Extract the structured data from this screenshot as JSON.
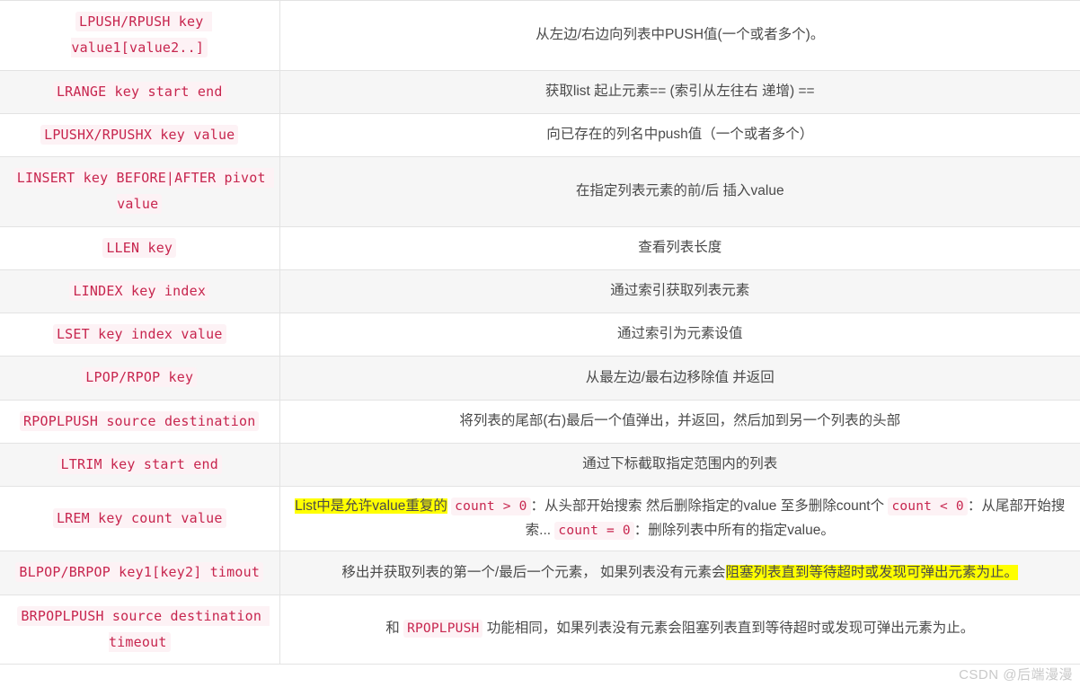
{
  "table": {
    "columns": [
      "command",
      "description"
    ],
    "rows": [
      {
        "command": "LPUSH/RPUSH key value1[value2..]",
        "description_parts": [
          {
            "type": "text",
            "text": "从左边/右边向列表中PUSH值(一个或者多个)。"
          }
        ],
        "striped": false
      },
      {
        "command": "LRANGE key start end",
        "description_parts": [
          {
            "type": "text",
            "text": "获取list 起止元素== (索引从左往右 递增) =="
          }
        ],
        "striped": true
      },
      {
        "command": "LPUSHX/RPUSHX key value",
        "description_parts": [
          {
            "type": "text",
            "text": "向已存在的列名中push值（一个或者多个）"
          }
        ],
        "striped": false
      },
      {
        "command": "LINSERT key BEFORE|AFTER pivot value",
        "description_parts": [
          {
            "type": "text",
            "text": "在指定列表元素的前/后 插入value"
          }
        ],
        "striped": true
      },
      {
        "command": "LLEN key",
        "description_parts": [
          {
            "type": "text",
            "text": "查看列表长度"
          }
        ],
        "striped": false
      },
      {
        "command": "LINDEX key index",
        "description_parts": [
          {
            "type": "text",
            "text": "通过索引获取列表元素"
          }
        ],
        "striped": true
      },
      {
        "command": "LSET key index value",
        "description_parts": [
          {
            "type": "text",
            "text": "通过索引为元素设值"
          }
        ],
        "striped": false
      },
      {
        "command": "LPOP/RPOP key",
        "description_parts": [
          {
            "type": "text",
            "text": "从最左边/最右边移除值 并返回"
          }
        ],
        "striped": true
      },
      {
        "command": "RPOPLPUSH source destination",
        "description_parts": [
          {
            "type": "text",
            "text": "将列表的尾部(右)最后一个值弹出，并返回，然后加到另一个列表的头部"
          }
        ],
        "striped": false
      },
      {
        "command": "LTRIM key start end",
        "description_parts": [
          {
            "type": "text",
            "text": "通过下标截取指定范围内的列表"
          }
        ],
        "striped": true
      },
      {
        "command": "LREM key count value",
        "description_parts": [
          {
            "type": "highlight",
            "text": "List中是允许value重复的"
          },
          {
            "type": "text",
            "text": " "
          },
          {
            "type": "code",
            "text": "count > 0"
          },
          {
            "type": "text",
            "text": "：从头部开始搜索 然后删除指定的value 至多删除count个 "
          },
          {
            "type": "code",
            "text": "count < 0"
          },
          {
            "type": "text",
            "text": "：从尾部开始搜索... "
          },
          {
            "type": "code",
            "text": "count = 0"
          },
          {
            "type": "text",
            "text": "：删除列表中所有的指定value。"
          }
        ],
        "striped": false
      },
      {
        "command": "BLPOP/BRPOP key1[key2] timout",
        "description_parts": [
          {
            "type": "text",
            "text": "移出并获取列表的第一个/最后一个元素， 如果列表没有元素会"
          },
          {
            "type": "highlight",
            "text": "阻塞列表直到等待超时或发现可弹出元素为止。"
          }
        ],
        "striped": true
      },
      {
        "command": "BRPOPLPUSH source destination timeout",
        "description_parts": [
          {
            "type": "text",
            "text": "和 "
          },
          {
            "type": "code",
            "text": "RPOPLPUSH"
          },
          {
            "type": "text",
            "text": " 功能相同，如果列表没有元素会阻塞列表直到等待超时或发现可弹出元素为止。"
          }
        ],
        "striped": false
      }
    ]
  },
  "watermark": {
    "text": "CSDN @后端漫漫"
  },
  "colors": {
    "code_text": "#c7254e",
    "code_background": "#fdf2f5",
    "highlight": "#ffff00",
    "row_stripe": "#f6f6f6",
    "border": "#e3e3e3",
    "body_text": "#4a4a4a",
    "watermark_text": "#c9c9c9"
  }
}
